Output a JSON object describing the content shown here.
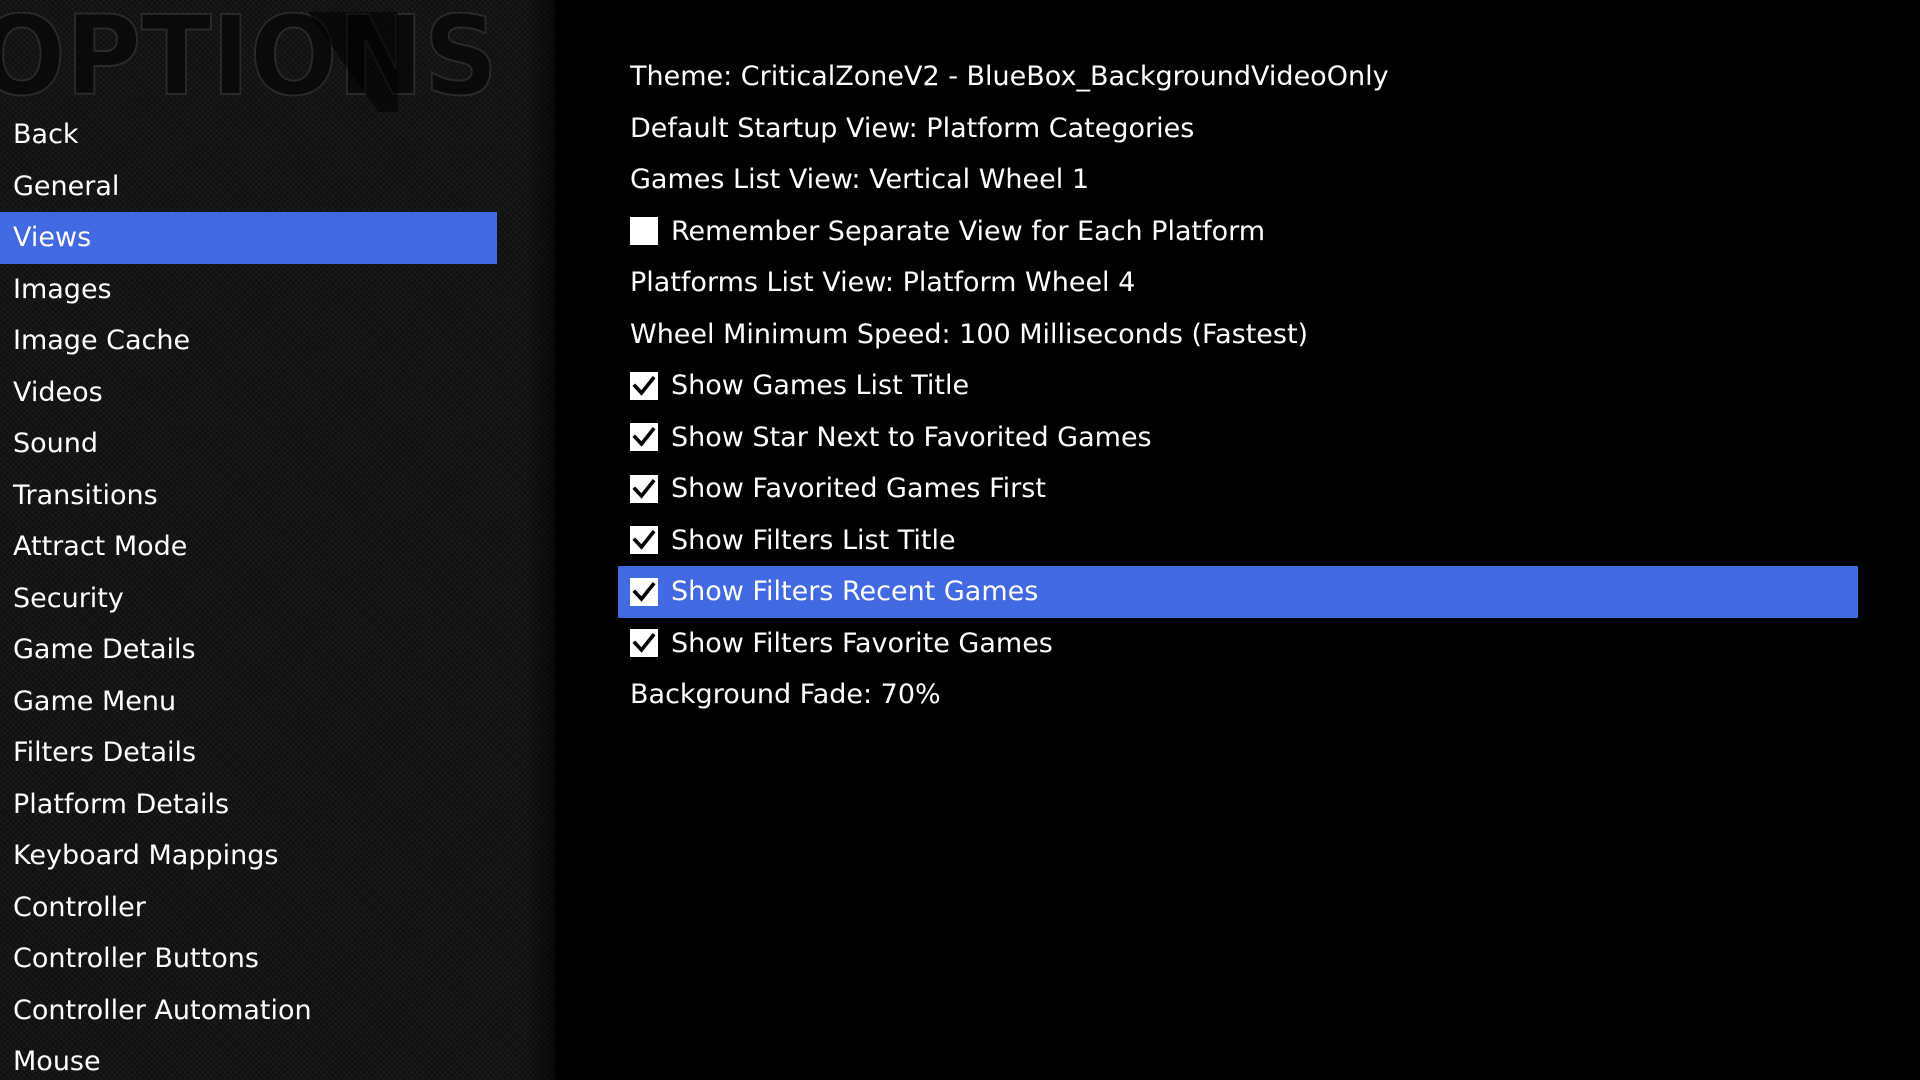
{
  "header": {
    "title": "OPTIONS"
  },
  "colors": {
    "accent": "#4169e1",
    "background": "#000000",
    "sidebar": "#141414",
    "text": "#ffffff"
  },
  "sidebar": {
    "selected": "Views",
    "items": [
      {
        "label": "Back"
      },
      {
        "label": "General"
      },
      {
        "label": "Views"
      },
      {
        "label": "Images"
      },
      {
        "label": "Image Cache"
      },
      {
        "label": "Videos"
      },
      {
        "label": "Sound"
      },
      {
        "label": "Transitions"
      },
      {
        "label": "Attract Mode"
      },
      {
        "label": "Security"
      },
      {
        "label": "Game Details"
      },
      {
        "label": "Game Menu"
      },
      {
        "label": "Filters Details"
      },
      {
        "label": "Platform Details"
      },
      {
        "label": "Keyboard Mappings"
      },
      {
        "label": "Controller"
      },
      {
        "label": "Controller Buttons"
      },
      {
        "label": "Controller Automation"
      },
      {
        "label": "Mouse"
      }
    ]
  },
  "settings": {
    "selected": "Show Filters Recent Games",
    "items": [
      {
        "label": "Theme: CriticalZoneV2 - BlueBox_BackgroundVideoOnly",
        "type": "value"
      },
      {
        "label": "Default Startup View: Platform Categories",
        "type": "value"
      },
      {
        "label": "Games List View: Vertical Wheel 1",
        "type": "value"
      },
      {
        "label": "Remember Separate View for Each Platform",
        "type": "checkbox",
        "checked": false
      },
      {
        "label": "Platforms List View: Platform Wheel 4",
        "type": "value"
      },
      {
        "label": "Wheel Minimum Speed: 100 Milliseconds (Fastest)",
        "type": "value"
      },
      {
        "label": "Show Games List Title",
        "type": "checkbox",
        "checked": true
      },
      {
        "label": "Show Star Next to Favorited Games",
        "type": "checkbox",
        "checked": true
      },
      {
        "label": "Show Favorited Games First",
        "type": "checkbox",
        "checked": true
      },
      {
        "label": "Show Filters List Title",
        "type": "checkbox",
        "checked": true
      },
      {
        "label": "Show Filters Recent Games",
        "type": "checkbox",
        "checked": true
      },
      {
        "label": "Show Filters Favorite Games",
        "type": "checkbox",
        "checked": true
      },
      {
        "label": "Background Fade: 70%",
        "type": "value"
      }
    ]
  }
}
